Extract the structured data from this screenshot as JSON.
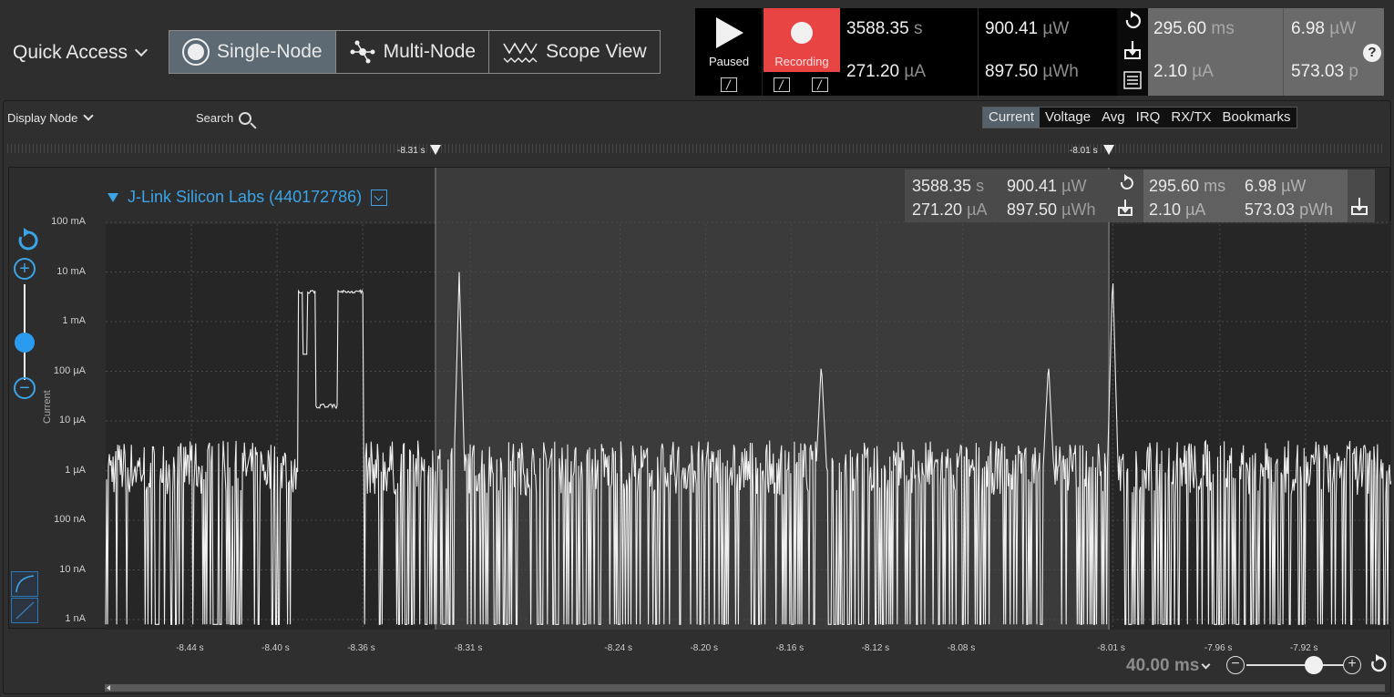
{
  "toolbar": {
    "quick_access": "Quick Access",
    "modes": [
      {
        "label": "Single-Node",
        "active": true,
        "icon": "radio-icon"
      },
      {
        "label": "Multi-Node",
        "active": false,
        "icon": "network-icon"
      },
      {
        "label": "Scope View",
        "active": false,
        "icon": "waveform-icon"
      }
    ],
    "paused_label": "Paused",
    "recording_label": "Recording",
    "stats": {
      "time": {
        "value": "3588.35",
        "unit": "s"
      },
      "power": {
        "value": "900.41",
        "unit": "µW"
      },
      "current": {
        "value": "271.20",
        "unit": "µA"
      },
      "energy": {
        "value": "897.50",
        "unit": "µWh"
      },
      "sel_time": {
        "value": "295.60",
        "unit": "ms"
      },
      "sel_power": {
        "value": "6.98",
        "unit": "µW"
      },
      "sel_current": {
        "value": "2.10",
        "unit": "µA"
      },
      "sel_energy": {
        "value": "573.03",
        "unit": "p"
      }
    },
    "help": "?"
  },
  "panel": {
    "display_node": "Display Node",
    "search": "Search",
    "tabs": [
      {
        "label": "Current",
        "active": true
      },
      {
        "label": "Voltage",
        "active": false
      },
      {
        "label": "Avg",
        "active": false
      },
      {
        "label": "IRQ",
        "active": false
      },
      {
        "label": "RX/TX",
        "active": false
      },
      {
        "label": "Bookmarks",
        "active": false
      }
    ],
    "markers": [
      {
        "label": "-8.31 s"
      },
      {
        "label": "-8.01 s"
      }
    ],
    "node_title": "J-Link Silicon Labs (440172786)",
    "selection_stats": {
      "time": {
        "value": "3588.35",
        "unit": "s"
      },
      "power": {
        "value": "900.41",
        "unit": "µW"
      },
      "current": {
        "value": "271.20",
        "unit": "µA"
      },
      "energy": {
        "value": "897.50",
        "unit": "µWh"
      },
      "sel_time": {
        "value": "295.60",
        "unit": "ms"
      },
      "sel_power": {
        "value": "6.98",
        "unit": "µW"
      },
      "sel_current": {
        "value": "2.10",
        "unit": "µA"
      },
      "sel_energy": {
        "value": "573.03",
        "unit": "pWh"
      }
    },
    "y_axis_label": "Current",
    "time_window": "40.00 ms"
  },
  "chart_data": {
    "type": "line",
    "ylabel": "Current",
    "y_scale": "log",
    "y_ticks": [
      "100 mA",
      "10 mA",
      "1 mA",
      "100 µA",
      "10 µA",
      "1 µA",
      "100 nA",
      "10 nA",
      "1 nA"
    ],
    "x_ticks": [
      "-8.44 s",
      "-8.40 s",
      "-8.36 s",
      "-8.31 s",
      "-8.24 s",
      "-8.20 s",
      "-8.16 s",
      "-8.12 s",
      "-8.08 s",
      "-8.01 s",
      "-7.96 s",
      "-7.92 s"
    ],
    "xlim_s": [
      -8.48,
      -7.88
    ],
    "grid": true,
    "events": [
      {
        "t_s": -8.39,
        "t_end_s": -8.36,
        "level_a": 0.004,
        "note": "plateau"
      },
      {
        "t_s": -8.382,
        "t_end_s": -8.372,
        "level_a": 2e-05
      },
      {
        "t_s": -8.315,
        "current_a": 0.01
      },
      {
        "t_s": -8.146,
        "current_a": 0.00015
      },
      {
        "t_s": -8.04,
        "current_a": 0.00015
      },
      {
        "t_s": -8.01,
        "current_a": 0.01
      }
    ],
    "baseline_a": 1e-06
  }
}
